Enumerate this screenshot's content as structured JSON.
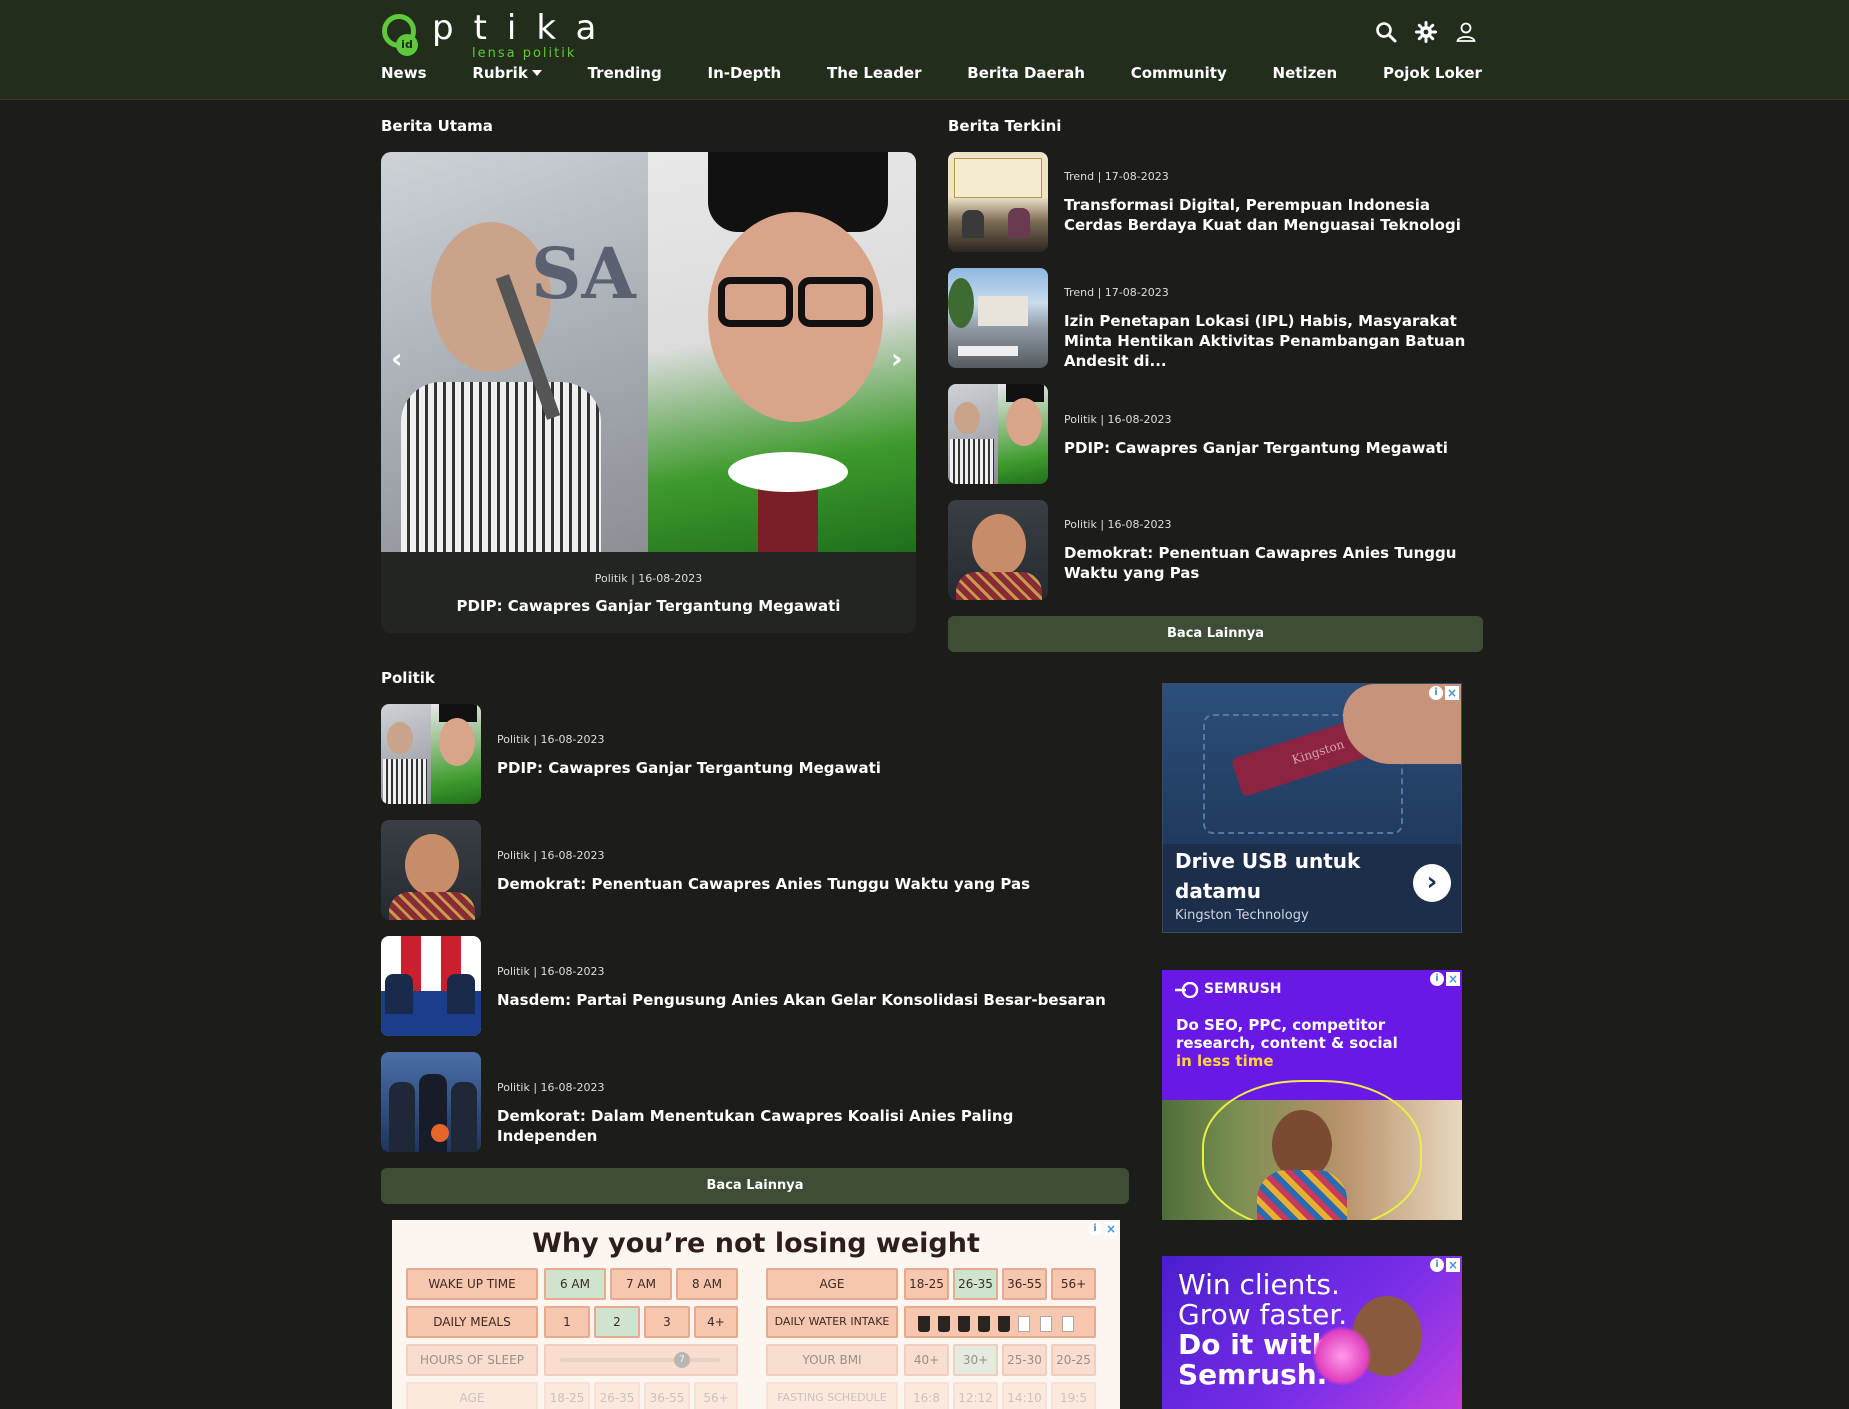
{
  "header": {
    "logo_word": "ptika",
    "logo_badge": "id",
    "logo_tagline": "lensa politik",
    "icons": [
      "search-icon",
      "gear-icon",
      "user-icon"
    ]
  },
  "nav": {
    "items": [
      "News",
      "Rubrik",
      "Trending",
      "In-Depth",
      "The Leader",
      "Berita Daerah",
      "Community",
      "Netizen",
      "Pojok Loker"
    ]
  },
  "berita_utama": {
    "title": "Berita Utama",
    "meta": "Politik | 16-08-2023",
    "headline": "PDIP: Cawapres Ganjar Tergantung Megawati"
  },
  "berita_terkini": {
    "title": "Berita Terkini",
    "items": [
      {
        "meta": "Trend | 17-08-2023",
        "title": "Transformasi Digital, Perempuan Indonesia Cerdas Berdaya Kuat dan Menguasai Teknologi"
      },
      {
        "meta": "Trend | 17-08-2023",
        "title": "Izin Penetapan Lokasi (IPL) Habis, Masyarakat Minta Hentikan Aktivitas Penambangan Batuan Andesit di..."
      },
      {
        "meta": "Politik | 16-08-2023",
        "title": "PDIP: Cawapres Ganjar Tergantung Megawati"
      },
      {
        "meta": "Politik | 16-08-2023",
        "title": "Demokrat: Penentuan Cawapres Anies Tunggu Waktu yang Pas"
      }
    ],
    "more_label": "Baca Lainnya"
  },
  "politik": {
    "title": "Politik",
    "items": [
      {
        "meta": "Politik | 16-08-2023",
        "title": "PDIP: Cawapres Ganjar Tergantung Megawati"
      },
      {
        "meta": "Politik | 16-08-2023",
        "title": "Demokrat: Penentuan Cawapres Anies Tunggu Waktu yang Pas"
      },
      {
        "meta": "Politik | 16-08-2023",
        "title": "Nasdem: Partai Pengusung Anies Akan Gelar Konsolidasi Besar-besaran"
      },
      {
        "meta": "Politik | 16-08-2023",
        "title": "Demkorat: Dalam Menentukan Cawapres Koalisi Anies Paling Independen"
      }
    ],
    "more_label": "Baca Lainnya"
  },
  "ads": {
    "kingston": {
      "title": "Drive USB untuk datamu",
      "advertiser": "Kingston Technology",
      "usb_label": "Kingston"
    },
    "semrush1": {
      "brand": "SEMRUSH",
      "text": "Do SEO, PPC, competitor research, content & social",
      "highlight": "in less time"
    },
    "semrush2": {
      "lines": [
        "Win clients.",
        "Grow faster.",
        "Do it with",
        "Semrush."
      ]
    },
    "weight": {
      "title": "Why you’re not losing weight",
      "left_rows": [
        {
          "label": "WAKE UP TIME",
          "opts": [
            "6 AM",
            "7 AM",
            "8 AM"
          ]
        },
        {
          "label": "DAILY MEALS",
          "opts": [
            "1",
            "2",
            "3",
            "4+"
          ]
        },
        {
          "label": "HOURS OF SLEEP",
          "slider": "7"
        },
        {
          "label": "AGE",
          "opts": [
            "18-25",
            "26-35",
            "36-55",
            "56+"
          ]
        }
      ],
      "right_rows": [
        {
          "label": "AGE",
          "opts": [
            "18-25",
            "26-35",
            "36-55",
            "56+"
          ]
        },
        {
          "label": "DAILY WATER INTAKE"
        },
        {
          "label": "YOUR BMI",
          "opts": [
            "40+",
            "30+",
            "25-30",
            "20-25"
          ]
        },
        {
          "label": "FASTING SCHEDULE",
          "opts": [
            "16:8",
            "12:12",
            "14:10",
            "19:5"
          ]
        }
      ]
    }
  },
  "colors": {
    "header_bg": "#222d1c",
    "accent_green": "#5ec93a",
    "button_bg": "#3e4d36",
    "page_bg": "#1c1d18"
  }
}
